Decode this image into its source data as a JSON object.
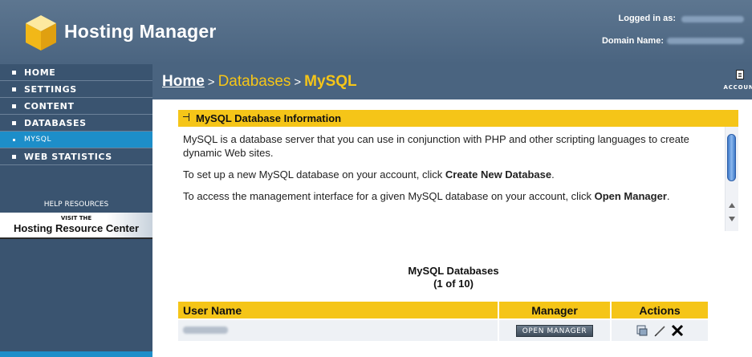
{
  "header": {
    "title": "Hosting Manager",
    "logged_in_label": "Logged in as:",
    "domain_label": "Domain Name:"
  },
  "sidebar": {
    "items": [
      {
        "label": "HOME"
      },
      {
        "label": "SETTINGS"
      },
      {
        "label": "CONTENT"
      },
      {
        "label": "DATABASES"
      },
      {
        "label": "MYSQL"
      },
      {
        "label": "WEB STATISTICS"
      }
    ],
    "help_title": "HELP RESOURCES",
    "help_banner_top": "VISIT THE",
    "help_banner_main": "Hosting Resource Center"
  },
  "breadcrumb": {
    "home": "Home",
    "sep1": ">",
    "databases": "Databases",
    "sep2": ">",
    "current": "MySQL"
  },
  "account": {
    "label": "ACCOUNT LI"
  },
  "info_panel": {
    "title": "MySQL Database Information",
    "p1": "MySQL is a database server that you can use in conjunction with PHP and other scripting languages to create dynamic Web sites.",
    "p2_prefix": "To set up a new MySQL database on your account, click ",
    "p2_bold": "Create New Database",
    "p2_suffix": ".",
    "p3_prefix": "To access the management interface for a given MySQL database on your account, click ",
    "p3_bold": "Open Manager",
    "p3_suffix": "."
  },
  "databases": {
    "title": "MySQL Databases",
    "count": "(1 of 10)",
    "columns": {
      "user": "User Name",
      "manager": "Manager",
      "actions": "Actions"
    },
    "rows": [
      {
        "manager_button": "OPEN MANAGER"
      }
    ]
  },
  "colors": {
    "accent_yellow": "#f5c518",
    "sidebar_bg": "#3a5470",
    "active_nav": "#1d8ec9"
  }
}
